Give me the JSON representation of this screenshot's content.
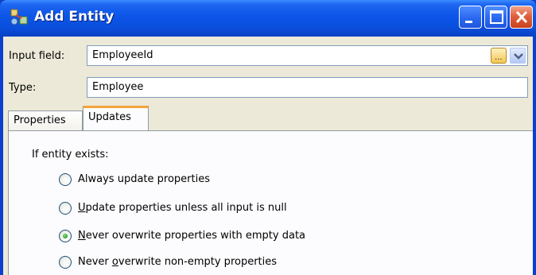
{
  "window": {
    "title": "Add Entity"
  },
  "fields": {
    "input_label": "Input field:",
    "input_value": "EmployeeId",
    "type_label": "Type:",
    "type_value": "Employee"
  },
  "tabs": [
    {
      "label": "Properties",
      "active": false
    },
    {
      "label": "Updates",
      "active": true
    }
  ],
  "updates": {
    "group_label": "If entity exists:",
    "options": [
      {
        "pre": "Always update properties",
        "mnemonic": "",
        "post": "",
        "selected": false
      },
      {
        "pre": "",
        "mnemonic": "U",
        "post": "pdate properties unless all input is null",
        "selected": false
      },
      {
        "pre": "",
        "mnemonic": "N",
        "post": "ever overwrite properties with empty data",
        "selected": true
      },
      {
        "pre": "Never ",
        "mnemonic": "o",
        "post": "verwrite non-empty properties",
        "selected": false
      }
    ]
  },
  "ellipsis_text": "...",
  "colors": {
    "titlebar": "#0a4fdc",
    "dialog_face": "#ece9d8",
    "tab_accent": "#f3a53a",
    "radio_selected": "#21a121"
  },
  "icons": {
    "app": "entity-app-icon",
    "minimize": "minimize-icon",
    "maximize": "maximize-icon",
    "close": "close-icon",
    "dropdown": "chevron-down-icon"
  }
}
